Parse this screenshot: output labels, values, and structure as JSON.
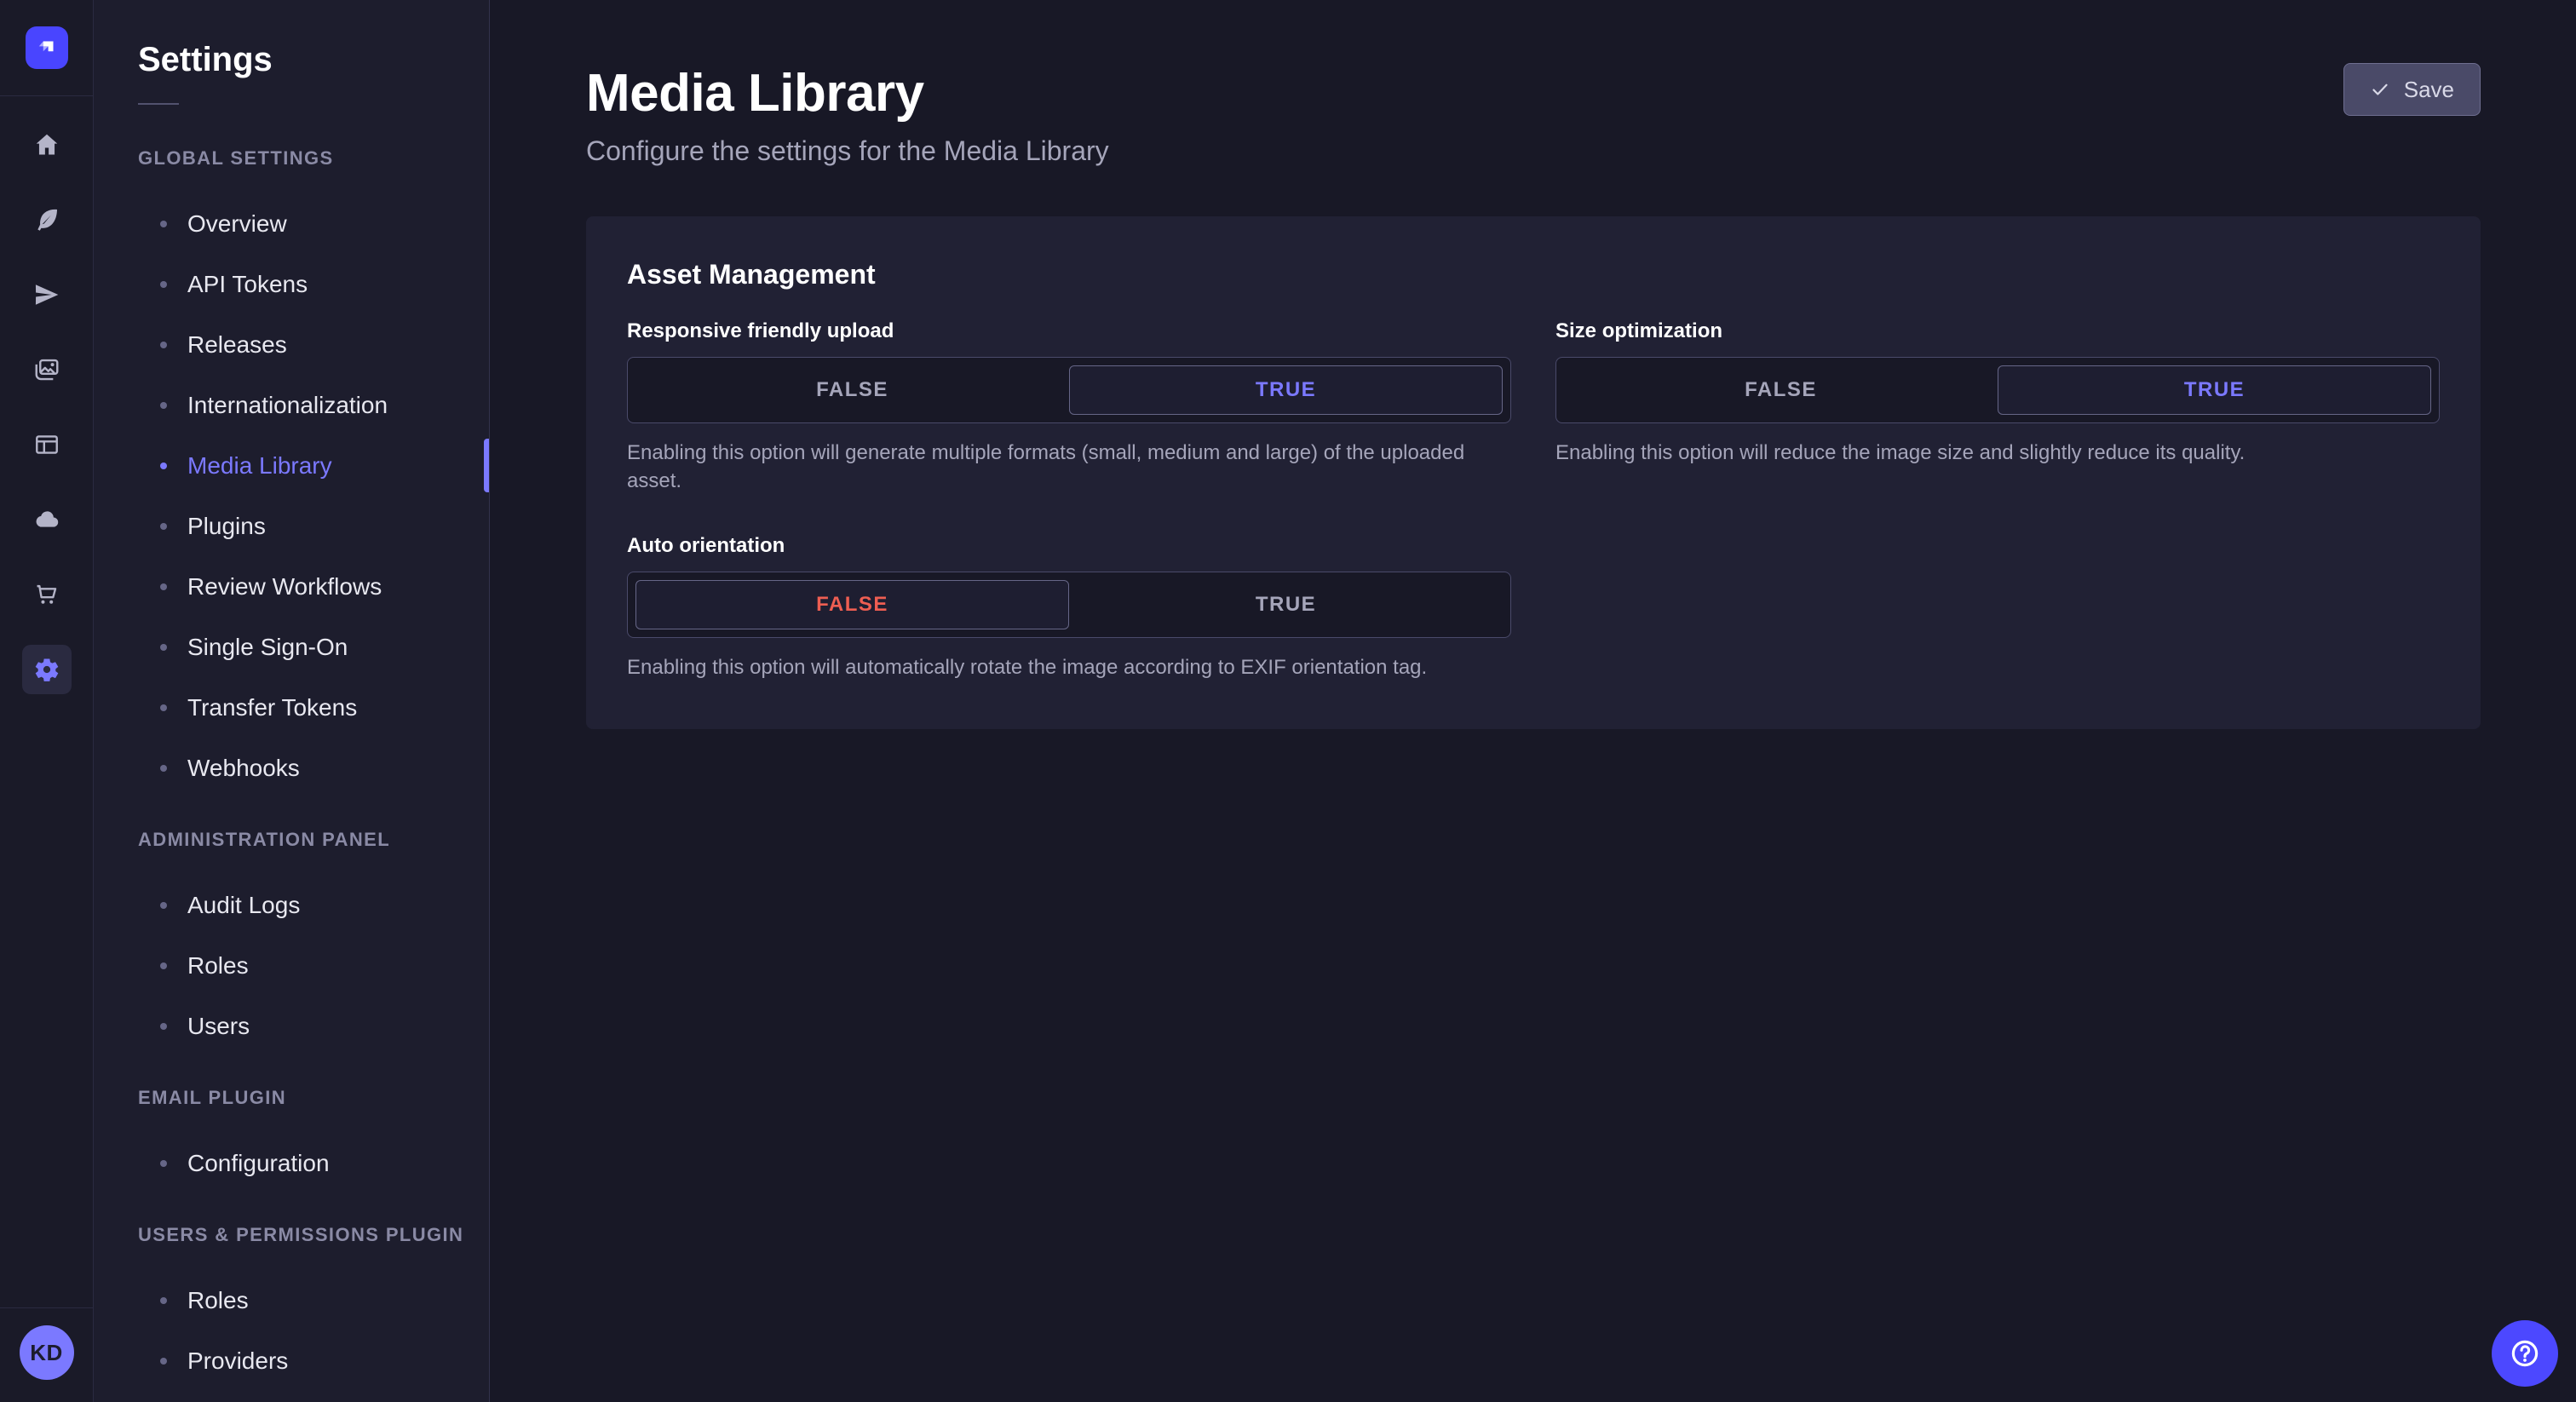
{
  "colors": {
    "accent": "#4945ff",
    "accent_light": "#7b79ff",
    "danger": "#ee5e52",
    "page_bg": "#181826",
    "panel_bg": "#212134"
  },
  "nav_rail": {
    "logo_icon": "strapi-logo",
    "items": [
      {
        "icon": "home-icon",
        "active": false
      },
      {
        "icon": "feather-icon",
        "active": false
      },
      {
        "icon": "paper-plane-icon",
        "active": false
      },
      {
        "icon": "images-icon",
        "active": false
      },
      {
        "icon": "layout-icon",
        "active": false
      },
      {
        "icon": "cloud-icon",
        "active": false
      },
      {
        "icon": "cart-icon",
        "active": false
      },
      {
        "icon": "gear-icon",
        "active": true
      }
    ],
    "avatar_initials": "KD"
  },
  "sidebar": {
    "title": "Settings",
    "sections": [
      {
        "label": "GLOBAL SETTINGS",
        "items": [
          {
            "label": "Overview",
            "active": false
          },
          {
            "label": "API Tokens",
            "active": false
          },
          {
            "label": "Releases",
            "active": false
          },
          {
            "label": "Internationalization",
            "active": false
          },
          {
            "label": "Media Library",
            "active": true
          },
          {
            "label": "Plugins",
            "active": false
          },
          {
            "label": "Review Workflows",
            "active": false
          },
          {
            "label": "Single Sign-On",
            "active": false
          },
          {
            "label": "Transfer Tokens",
            "active": false
          },
          {
            "label": "Webhooks",
            "active": false
          }
        ]
      },
      {
        "label": "ADMINISTRATION PANEL",
        "items": [
          {
            "label": "Audit Logs",
            "active": false
          },
          {
            "label": "Roles",
            "active": false
          },
          {
            "label": "Users",
            "active": false
          }
        ]
      },
      {
        "label": "EMAIL PLUGIN",
        "items": [
          {
            "label": "Configuration",
            "active": false
          }
        ]
      },
      {
        "label": "USERS & PERMISSIONS PLUGIN",
        "items": [
          {
            "label": "Roles",
            "active": false
          },
          {
            "label": "Providers",
            "active": false
          }
        ]
      }
    ]
  },
  "header": {
    "title": "Media Library",
    "subtitle": "Configure the settings for the Media Library",
    "save_label": "Save",
    "save_icon": "check-icon"
  },
  "panel": {
    "title": "Asset Management",
    "settings": [
      {
        "label": "Responsive friendly upload",
        "false_label": "FALSE",
        "true_label": "TRUE",
        "value": "TRUE",
        "description": "Enabling this option will generate multiple formats (small, medium and large) of the uploaded asset."
      },
      {
        "label": "Size optimization",
        "false_label": "FALSE",
        "true_label": "TRUE",
        "value": "TRUE",
        "description": "Enabling this option will reduce the image size and slightly reduce its quality."
      },
      {
        "label": "Auto orientation",
        "false_label": "FALSE",
        "true_label": "TRUE",
        "value": "FALSE",
        "description": "Enabling this option will automatically rotate the image according to EXIF orientation tag."
      }
    ]
  },
  "help": {
    "icon": "question-mark-icon"
  }
}
